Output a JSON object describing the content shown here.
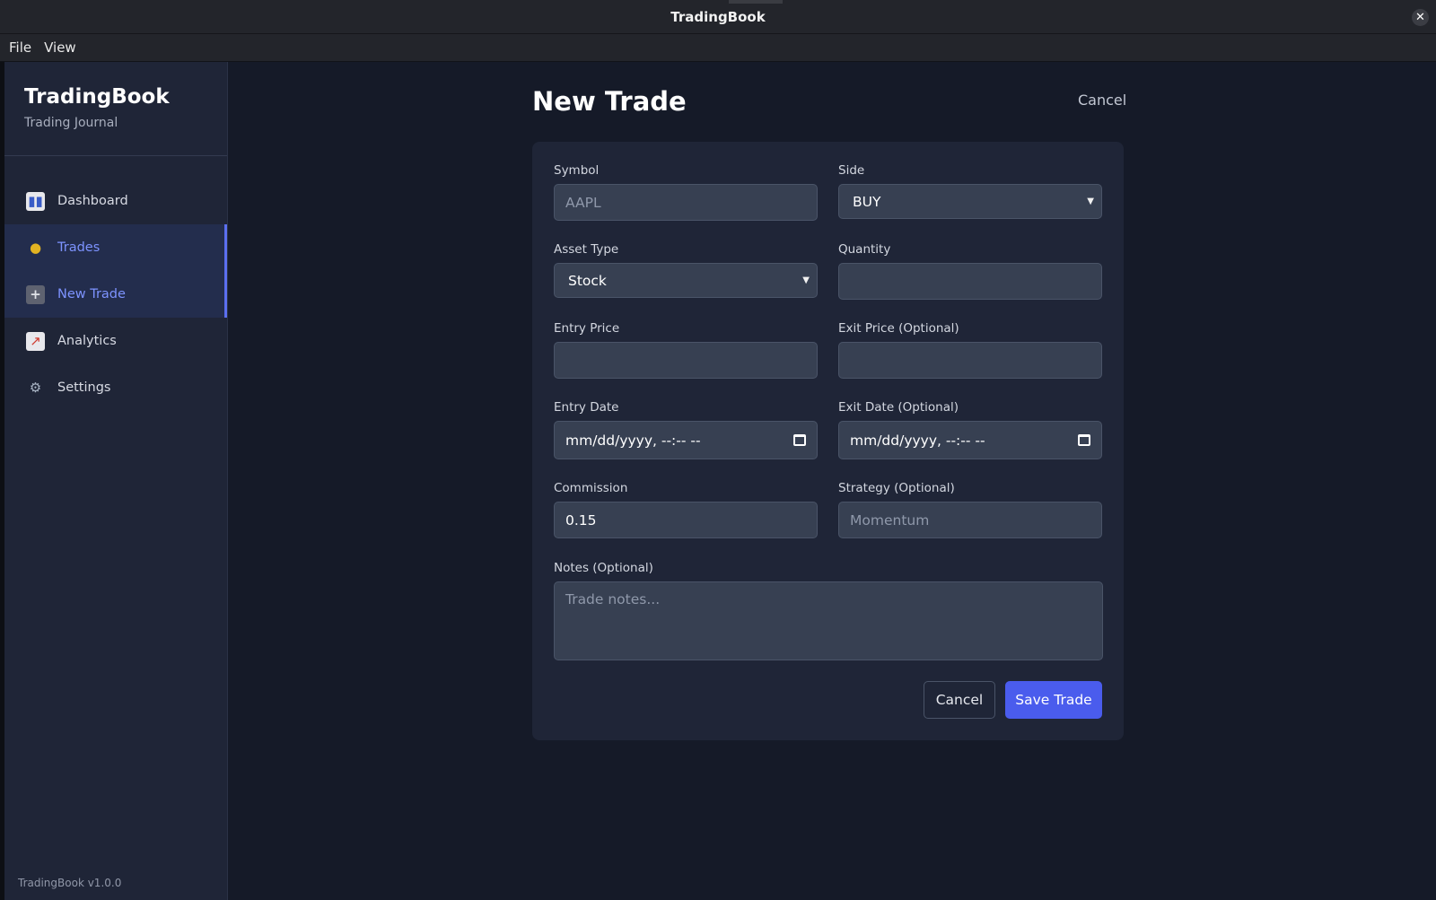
{
  "window": {
    "title": "TradingBook",
    "close_glyph": "✕"
  },
  "menu": {
    "file": "File",
    "view": "View"
  },
  "sidebar": {
    "app_name": "TradingBook",
    "app_subtitle": "Trading Journal",
    "items": [
      {
        "label": "Dashboard",
        "icon": "bar-chart-icon"
      },
      {
        "label": "Trades",
        "icon": "money-bag-icon"
      },
      {
        "label": "New Trade",
        "icon": "plus-icon"
      },
      {
        "label": "Analytics",
        "icon": "line-chart-icon"
      },
      {
        "label": "Settings",
        "icon": "gear-icon"
      }
    ],
    "active_items": [
      "Trades",
      "New Trade"
    ],
    "version": "TradingBook v1.0.0"
  },
  "page": {
    "title": "New Trade",
    "header_cancel": "Cancel"
  },
  "form": {
    "symbol": {
      "label": "Symbol",
      "value": "",
      "placeholder": "AAPL"
    },
    "side": {
      "label": "Side",
      "value": "BUY"
    },
    "asset_type": {
      "label": "Asset Type",
      "value": "Stock"
    },
    "quantity": {
      "label": "Quantity",
      "value": ""
    },
    "entry_price": {
      "label": "Entry Price",
      "value": ""
    },
    "exit_price": {
      "label": "Exit Price (Optional)",
      "value": ""
    },
    "entry_date": {
      "label": "Entry Date",
      "value": "mm/dd/yyyy, --:-- --"
    },
    "exit_date": {
      "label": "Exit Date (Optional)",
      "value": "mm/dd/yyyy, --:-- --"
    },
    "commission": {
      "label": "Commission",
      "value": "0.15"
    },
    "strategy": {
      "label": "Strategy (Optional)",
      "value": "",
      "placeholder": "Momentum"
    },
    "notes": {
      "label": "Notes (Optional)",
      "value": "",
      "placeholder": "Trade notes..."
    },
    "cancel_label": "Cancel",
    "save_label": "Save Trade"
  },
  "colors": {
    "accent": "#4a5ced",
    "active_nav_text": "#7d93ff",
    "background": "#151a28",
    "card": "#1f2537"
  }
}
